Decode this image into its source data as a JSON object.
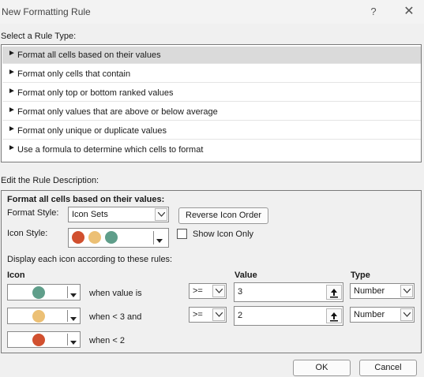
{
  "window": {
    "title": "New Formatting Rule",
    "help_label": "?",
    "close_label": "✕"
  },
  "rule_type": {
    "label": "Select a Rule Type:",
    "items": [
      "Format all cells based on their values",
      "Format only cells that contain",
      "Format only top or bottom ranked values",
      "Format only values that are above or below average",
      "Format only unique or duplicate values",
      "Use a formula to determine which cells to format"
    ],
    "selected_index": 0
  },
  "description": {
    "label": "Edit the Rule Description:",
    "heading": "Format all cells based on their values:",
    "format_style_label": "Format Style:",
    "format_style_value": "Icon Sets",
    "reverse_button": "Reverse Icon Order",
    "icon_style_label": "Icon Style:",
    "show_icon_only_label": "Show Icon Only",
    "show_icon_only_checked": false,
    "rules_caption": "Display each icon according to these rules:",
    "col_icon": "Icon",
    "col_value": "Value",
    "col_type": "Type",
    "rows": [
      {
        "icon_color": "green",
        "condition": "when value is",
        "operator": ">=",
        "value": "3",
        "type": "Number"
      },
      {
        "icon_color": "yellow",
        "condition": "when < 3 and",
        "operator": ">=",
        "value": "2",
        "type": "Number"
      },
      {
        "icon_color": "red",
        "condition": "when < 2"
      }
    ]
  },
  "colors": {
    "red": "#d1502f",
    "yellow": "#ecc075",
    "green": "#5f9e8a"
  },
  "buttons": {
    "ok": "OK",
    "cancel": "Cancel"
  }
}
